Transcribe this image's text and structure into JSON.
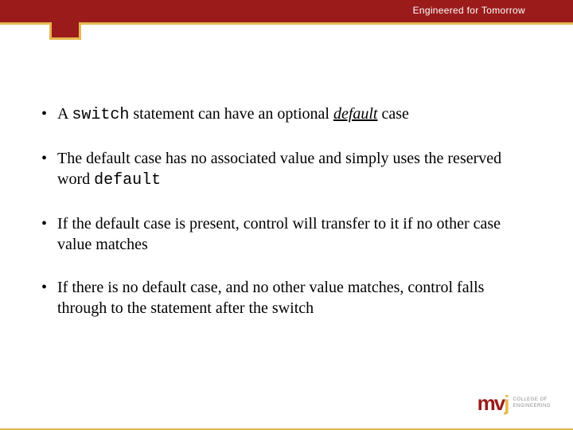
{
  "header": {
    "tagline": "Engineered for Tomorrow"
  },
  "bullets": [
    {
      "prefix": "A ",
      "code1": "switch",
      "mid1": " statement can have an optional ",
      "emph": "default",
      "mid2": " case",
      "code2": "",
      "suffix": ""
    },
    {
      "prefix": "The default case has no associated value and simply uses the reserved word ",
      "code1": "default",
      "mid1": "",
      "emph": "",
      "mid2": "",
      "code2": "",
      "suffix": ""
    },
    {
      "prefix": "If the default case is present, control will transfer to it if no other case value matches",
      "code1": "",
      "mid1": "",
      "emph": "",
      "mid2": "",
      "code2": "",
      "suffix": ""
    },
    {
      "prefix": "If there is no default case, and no other value matches, control falls through to the statement after the switch",
      "code1": "",
      "mid1": "",
      "emph": "",
      "mid2": "",
      "code2": "",
      "suffix": ""
    }
  ],
  "logo": {
    "mark_m": "m",
    "mark_v": "v",
    "mark_j": "j",
    "text_line1": "COLLEGE OF",
    "text_line2": "ENGINEERING",
    "text_line3": ""
  }
}
